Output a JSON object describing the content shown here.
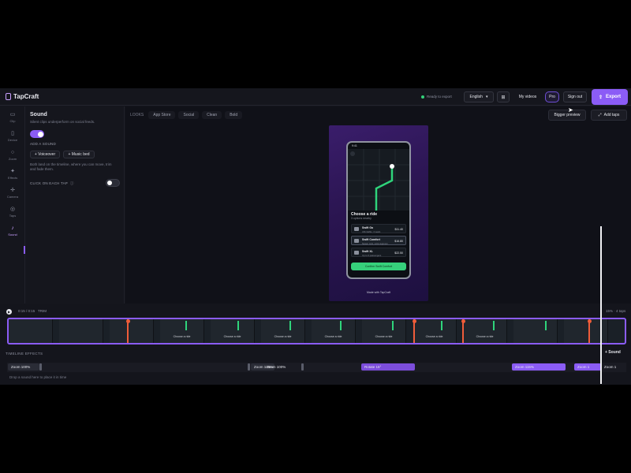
{
  "app": {
    "name": "TapCraft"
  },
  "header": {
    "status": "Ready to export",
    "language": "English",
    "grid_icon": "grid-icon",
    "my_videos": "My videos",
    "pro": "Pro",
    "sign_out": "Sign out",
    "export": "Export"
  },
  "rail": [
    {
      "label": "Clip",
      "icon": "film-icon"
    },
    {
      "label": "Device",
      "icon": "phone-icon"
    },
    {
      "label": "Zoom",
      "icon": "zoom-icon"
    },
    {
      "label": "Effects",
      "icon": "sparkle-icon"
    },
    {
      "label": "Camera",
      "icon": "crosshair-icon"
    },
    {
      "label": "Taps",
      "icon": "tap-icon"
    },
    {
      "label": "Sound",
      "icon": "note-icon"
    }
  ],
  "panel": {
    "title": "Sound",
    "subtitle": "Silent clips underperform on social feeds.",
    "add_a_sound": "ADD A SOUND",
    "voiceover": "+ Voiceover",
    "music_bed": "+ Music bed",
    "help": "Both land on the timeline, where you can move, trim and fade them.",
    "click_on_each_tap": "CLICK ON EACH TAP"
  },
  "preview": {
    "looks_label": "LOOKS",
    "looks": [
      "App Store",
      "Social",
      "Clean",
      "Bold"
    ],
    "bigger_preview": "Bigger preview",
    "add_taps": "Add taps",
    "made_with": "Made with TapCraft"
  },
  "phone": {
    "status": "9:41",
    "title": "Choose a ride",
    "subtitle": "3 options nearby",
    "rides": [
      {
        "name": "Swift Go",
        "desc": "Affordable, 4 seats",
        "price": "$11.40"
      },
      {
        "name": "Swift Comfort",
        "desc": "Newer cars, extra legroom",
        "price": "$16.80"
      },
      {
        "name": "Swift XL",
        "desc": "Up to 6 passengers",
        "price": "$22.50"
      }
    ],
    "confirm": "Confirm Swift Comfort"
  },
  "timeline": {
    "time": "0:15 / 0:15",
    "mode": "TRIM",
    "zoom_info": "15% · 4 taps",
    "frame_label": "Choose a ride",
    "effects_header": "TIMELINE EFFECTS",
    "add_sound": "+ Sound",
    "effects": [
      {
        "label": "Zoom 100%",
        "kind": "zoom"
      },
      {
        "label": "Zoom 100%",
        "kind": "zoom"
      },
      {
        "label": "Zoom 100%",
        "kind": "zoom"
      },
      {
        "label": "Rotate 15°",
        "kind": "rotate"
      },
      {
        "label": "Zoom 115%",
        "kind": "zoomp"
      },
      {
        "label": "Zoom 1",
        "kind": "zoomp"
      },
      {
        "label": "Zoom 1",
        "kind": "zoom"
      }
    ],
    "drop_hint": "Drop a sound here to place it in time"
  }
}
